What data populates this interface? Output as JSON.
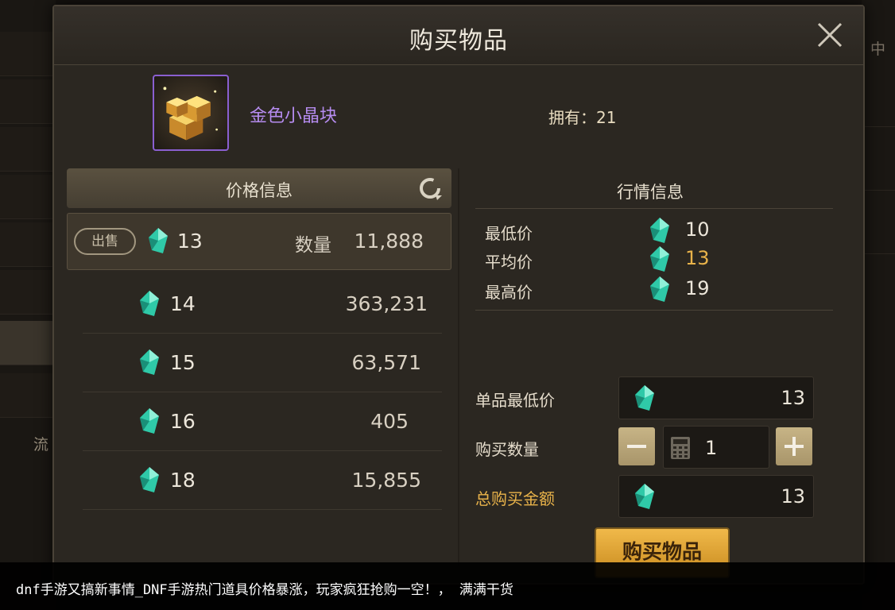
{
  "background": {
    "left_char": "流",
    "right_char": "中"
  },
  "modal": {
    "title": "购买物品"
  },
  "item": {
    "name": "金色小晶块",
    "owned_label": "拥有：",
    "owned_value": "21",
    "icon": "gold-crystal-block-icon"
  },
  "price_info": {
    "title": "价格信息",
    "selected": {
      "tag": "出售",
      "price": "13",
      "qty_label": "数量",
      "qty": "11,888"
    },
    "rows": [
      {
        "price": "14",
        "qty": "363,231"
      },
      {
        "price": "15",
        "qty": "63,571"
      },
      {
        "price": "16",
        "qty": "405"
      },
      {
        "price": "18",
        "qty": "15,855"
      }
    ]
  },
  "market_info": {
    "title": "行情信息",
    "lowest_label": "最低价",
    "lowest": "10",
    "average_label": "平均价",
    "average": "13",
    "highest_label": "最高价",
    "highest": "19"
  },
  "purchase": {
    "unit_min_label": "单品最低价",
    "unit_min": "13",
    "qty_label": "购买数量",
    "qty": "1",
    "total_label": "总购买金额",
    "total": "13",
    "buy_button": "购买物品"
  },
  "caption": "dnf手游又搞新事情_DNF手游热门道具价格暴涨，玩家疯狂抢购一空！， 满满干货",
  "colors": {
    "accent_gold": "#e9b34a",
    "item_purple": "#b68cf0",
    "gem_teal": "#2fc9a8"
  }
}
